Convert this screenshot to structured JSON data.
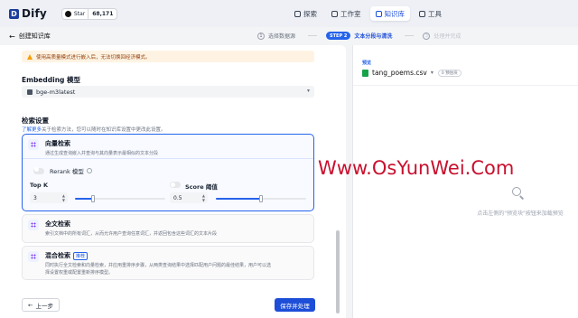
{
  "topbar": {
    "app_name": "Dify",
    "logo_letter": "D",
    "github_label": "Star",
    "github_count": "68,171",
    "nav": [
      {
        "label": "探索"
      },
      {
        "label": "工作室"
      },
      {
        "label": "知识库",
        "active": true
      },
      {
        "label": "工具"
      }
    ]
  },
  "header": {
    "back_label": "创建知识库",
    "steps": [
      {
        "num": "1",
        "label": "选择数据源"
      },
      {
        "num": "STEP 2",
        "label": "文本分段与清洗",
        "active": true
      },
      {
        "num": "3",
        "label": "处理并完成"
      }
    ]
  },
  "settings": {
    "warning": "使用高质量模式进行嵌入后，无法切换回经济模式。",
    "embedding_label": "Embedding 模型",
    "embedding_value": "bge-m3latest",
    "retrieval_label": "检索设置",
    "retrieval_link": "了解更多",
    "retrieval_desc": "关于检索方法，您可以随时在知识库设置中更改此设置。",
    "vector": {
      "title": "向量检索",
      "desc": "通过生成查询嵌入并查询与其向量表示最相似的文本分段",
      "rerank_label": "Rerank 模型",
      "topk_label": "Top K",
      "topk_value": "3",
      "topk_level": 0.2,
      "score_label": "Score 阈值",
      "score_value": "0.5",
      "score_level": 0.5
    },
    "fulltext": {
      "title": "全文检索",
      "desc": "索引文档中的所有词汇，从而允许用户查询任意词汇，并返回包含这些词汇的文本片段"
    },
    "hybrid": {
      "title": "混合检索",
      "badge": "推荐",
      "desc1": "同时执行全文检索和向量检索，并应用重排序步骤，从两类查询结果中选择匹配用户问题的最佳结果，用户可以选",
      "desc2": "择设置权重或配置重新排序模型。"
    },
    "prev_button": "上一步",
    "save_button": "保存并处理"
  },
  "preview": {
    "label": "预览",
    "file_name": "tang_poems.csv",
    "count": "0 预估块",
    "hint": "点击左侧的\"预览块\"按钮来加载预览"
  },
  "watermark": "Www.OsYunWei.Com",
  "colors": {
    "accent": "#1d4ed8",
    "watermark": "#c8102e"
  }
}
